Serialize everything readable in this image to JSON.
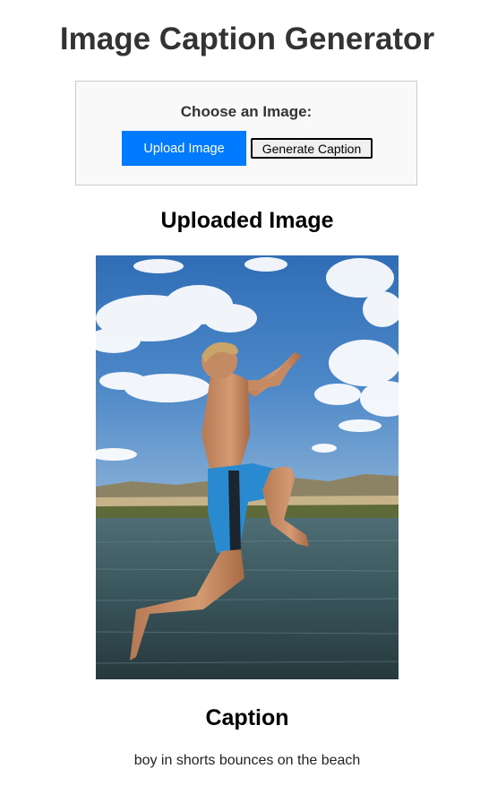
{
  "header": {
    "title": "Image Caption Generator"
  },
  "upload_panel": {
    "label": "Choose an Image:",
    "upload_button": "Upload Image",
    "generate_button": "Generate Caption"
  },
  "preview": {
    "heading": "Uploaded Image"
  },
  "caption": {
    "heading": "Caption",
    "text": "boy in shorts bounces on the beach"
  },
  "colors": {
    "accent": "#007bff",
    "title_text": "#333333",
    "panel_background": "#f9f9f9",
    "panel_border": "#cccccc"
  }
}
